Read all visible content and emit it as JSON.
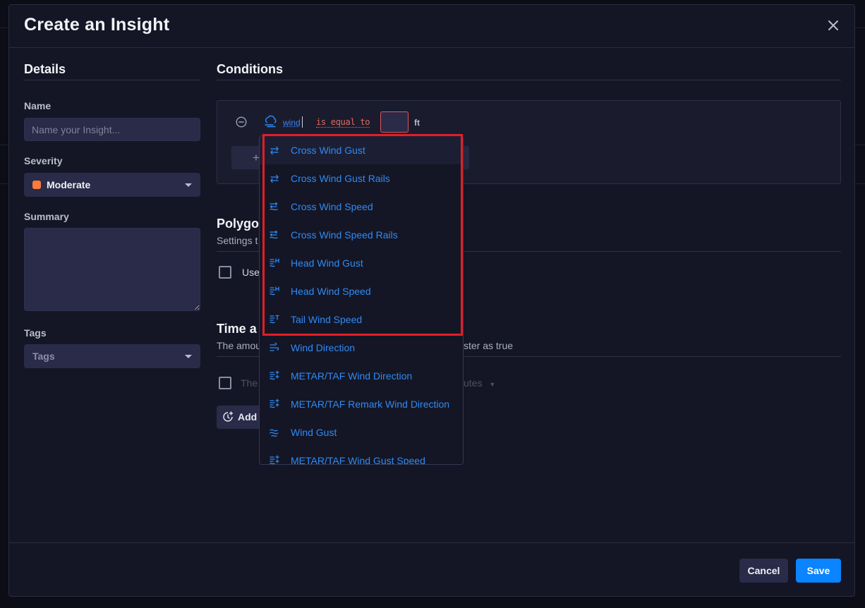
{
  "modal": {
    "title": "Create an Insight"
  },
  "details": {
    "title": "Details",
    "name_label": "Name",
    "name_placeholder": "Name your Insight...",
    "severity_label": "Severity",
    "severity_value": "Moderate",
    "severity_color": "#ff7a3d",
    "summary_label": "Summary",
    "tags_label": "Tags",
    "tags_placeholder": "Tags"
  },
  "conditions": {
    "title": "Conditions",
    "variable": "wind",
    "operator": "is equal to",
    "unit": "ft",
    "add_button_icon": "plus"
  },
  "polygon": {
    "title_visible": "Polygo",
    "subtitle_visible": "Settings t",
    "checkbox_label_visible": "Use"
  },
  "time": {
    "title_visible": "Time a",
    "subtitle_left": "The amou",
    "subtitle_right": "ster as true",
    "row_text_visible": "The",
    "row_select_visible": "utes",
    "add_button_label": "Add"
  },
  "dropdown": {
    "items": [
      {
        "label": "Cross Wind Gust",
        "icon": "crosswind-icon"
      },
      {
        "label": "Cross Wind Gust Rails",
        "icon": "crosswind-icon"
      },
      {
        "label": "Cross Wind Speed",
        "icon": "crosswind-speed-icon"
      },
      {
        "label": "Cross Wind Speed Rails",
        "icon": "crosswind-speed-icon"
      },
      {
        "label": "Head Wind Gust",
        "icon": "headwind-icon"
      },
      {
        "label": "Head Wind Speed",
        "icon": "headwind-icon"
      },
      {
        "label": "Tail Wind Speed",
        "icon": "tailwind-icon"
      },
      {
        "label": "Wind Direction",
        "icon": "wind-direction-icon"
      },
      {
        "label": "METAR/TAF Wind Direction",
        "icon": "metar-wind-icon"
      },
      {
        "label": "METAR/TAF Remark Wind Direction",
        "icon": "metar-wind-icon"
      },
      {
        "label": "Wind Gust",
        "icon": "wind-gust-icon"
      },
      {
        "label": "METAR/TAF Wind Gust Speed",
        "icon": "metar-wind-icon"
      }
    ]
  },
  "footer": {
    "cancel_label": "Cancel",
    "save_label": "Save"
  },
  "colors": {
    "accent": "#0a84ff",
    "link": "#2f8af5",
    "highlight": "#e21e26",
    "modal_bg": "#141625"
  }
}
